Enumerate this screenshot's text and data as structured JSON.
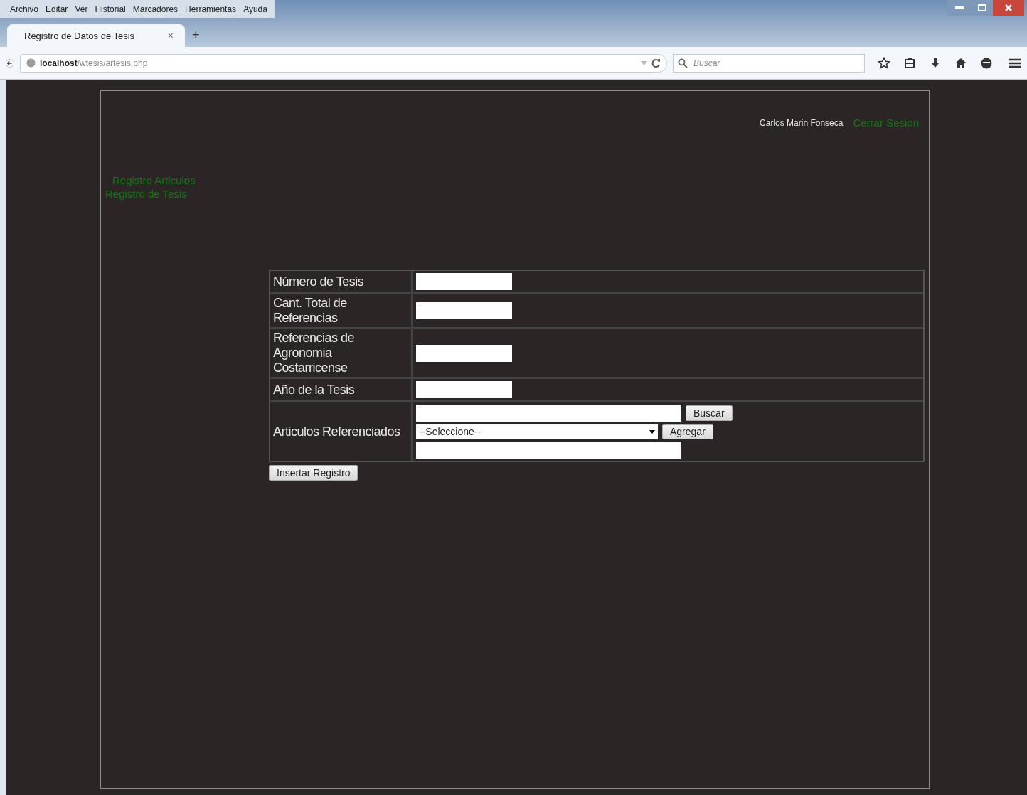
{
  "menu_bar": [
    "Archivo",
    "Editar",
    "Ver",
    "Historial",
    "Marcadores",
    "Herramientas",
    "Ayuda"
  ],
  "tabs": [
    {
      "title": "Registro de Datos de Tesis",
      "selected": true,
      "close": "×"
    }
  ],
  "new_tab": "+",
  "address_bar": {
    "host": "localhost",
    "path": "/wtesis/artesis.php"
  },
  "search": {
    "placeholder": "Buscar"
  },
  "header": {
    "user": "Carlos Marin Fonseca",
    "logout": "Cerrar Sesion"
  },
  "nav_links": [
    "Registro Articulos",
    "Registro de Tesis"
  ],
  "form": {
    "rows": [
      {
        "label": "Número de Tesis",
        "kind": "text"
      },
      {
        "label": "Cant. Total de Referencias",
        "kind": "text"
      },
      {
        "label": "Referencias de Agronomia Costarricense",
        "kind": "text"
      },
      {
        "label": "Año de la Tesis",
        "kind": "text"
      },
      {
        "label": "Articulos Referenciados",
        "kind": "articles",
        "search_button": "Buscar",
        "select": "--Seleccione--",
        "add_button": "Agregar"
      }
    ],
    "submit": "Insertar Registro"
  }
}
